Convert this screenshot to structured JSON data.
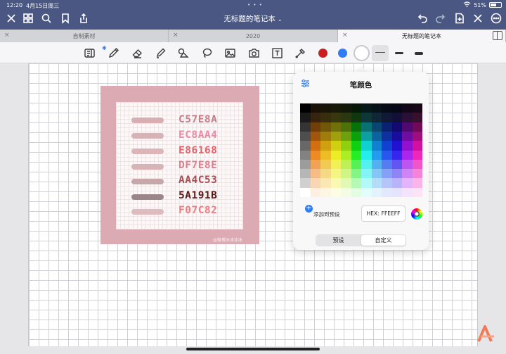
{
  "status": {
    "time": "12:20",
    "date": "4月15日周三",
    "battery": "51%",
    "more": "• • •"
  },
  "header": {
    "title": "无标题的笔记本",
    "title_chevron": "⌄"
  },
  "tabs": [
    {
      "label": "自制素材",
      "close": "×"
    },
    {
      "label": "2020",
      "close": "×"
    },
    {
      "label": "无标题的笔记本",
      "close": "×"
    }
  ],
  "toolbar": {
    "bluetooth": "✱",
    "colors": {
      "red": "#c8201e",
      "blue": "#2f7cf6",
      "selected": "#ffffff"
    }
  },
  "image": {
    "swatches": [
      {
        "hex": "#C57E8A",
        "label": "C57E8A"
      },
      {
        "hex": "#EC8AA4",
        "label": "EC8AA4"
      },
      {
        "hex": "#E86168",
        "label": "E86168"
      },
      {
        "hex": "#DF7E8E",
        "label": "DF7E8E"
      },
      {
        "hex": "#AA4C53",
        "label": "AA4C53"
      },
      {
        "hex": "#5A191B",
        "label": "5A191B"
      },
      {
        "hex": "#F07C82",
        "label": "F07C82"
      }
    ],
    "stroke_colors": [
      "#d9aeb3",
      "#d7b3b6",
      "#ddb5b8",
      "#d9b4b7",
      "#c7a8aa",
      "#9b8789",
      "#e0bbbd"
    ],
    "watermark": "@微博冰冰冰冰"
  },
  "popover": {
    "title": "笔颜色",
    "add_preset": "添加到预设",
    "add_symbol": "+",
    "hex_label": "HEX:",
    "hex_value": "FFEEFF",
    "seg_preset": "预设",
    "seg_custom": "自定义"
  }
}
